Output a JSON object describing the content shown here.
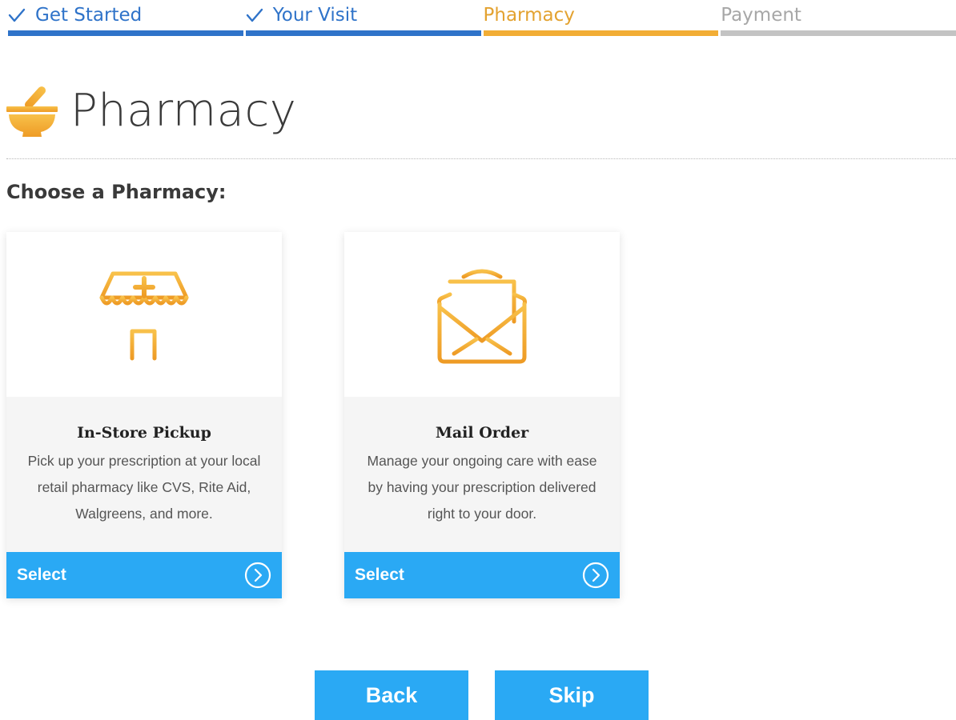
{
  "steps": [
    {
      "label": "Get Started",
      "state": "done"
    },
    {
      "label": "Your Visit",
      "state": "done"
    },
    {
      "label": "Pharmacy",
      "state": "current"
    },
    {
      "label": "Payment",
      "state": "todo"
    }
  ],
  "header": {
    "icon": "mortar-pestle-icon",
    "title": "Pharmacy"
  },
  "section_title": "Choose a Pharmacy:",
  "cards": [
    {
      "icon": "storefront-icon",
      "title": "In-Store Pickup",
      "description": "Pick up your prescription at your local retail pharmacy like CVS, Rite Aid, Walgreens, and more.",
      "button_label": "Select",
      "button_icon": "chevron-right-circle-icon"
    },
    {
      "icon": "open-envelope-icon",
      "title": "Mail Order",
      "description": "Manage your ongoing care with ease by having your prescription delivered right to your door.",
      "button_label": "Select",
      "button_icon": "chevron-right-circle-icon"
    }
  ],
  "nav": {
    "back_label": "Back",
    "skip_label": "Skip"
  },
  "colors": {
    "done": "#2f73c9",
    "current": "#f2ad35",
    "todo": "#c3c3c3",
    "button": "#2aa9f4",
    "icon_accent": "#f2ad35"
  }
}
